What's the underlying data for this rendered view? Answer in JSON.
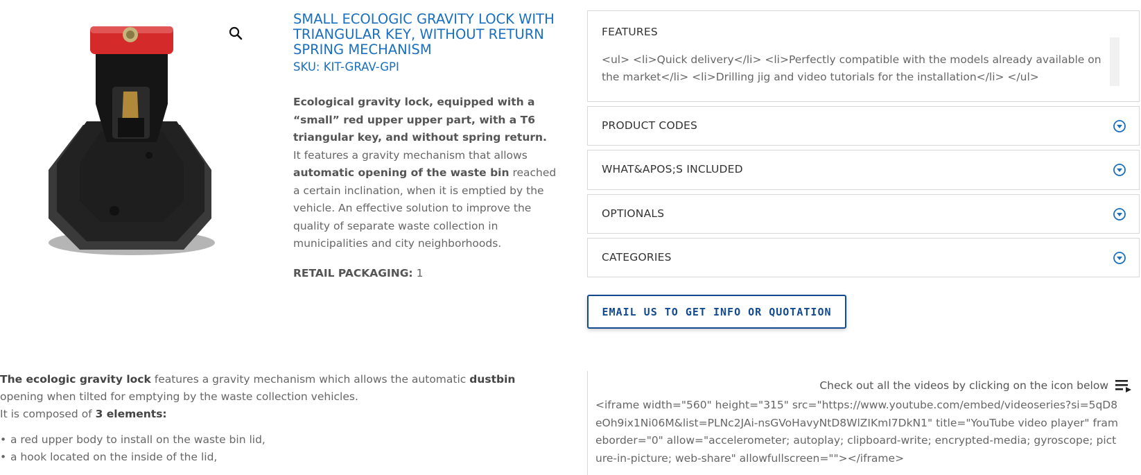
{
  "product": {
    "title": "SMALL ECOLOGIC GRAVITY LOCK WITH TRIANGULAR KEY, WITHOUT RETURN SPRING MECHANISM",
    "sku": "SKU: KIT-GRAV-GPI",
    "desc_bold_1": "Ecological gravity lock, equipped with a “small” red upper upper part, with a T6 triangular key, and without spring return.",
    "desc_1": " It features a gravity mechanism that allows ",
    "desc_bold_2": "automatic opening of the waste bin",
    "desc_2": " reached a certain inclination, when it is emptied by the vehicle. An effective solution to improve the quality of separate waste collection in municipalities and city neighborhoods.",
    "retail_label": "RETAIL PACKAGING:",
    "retail_value": " 1",
    "zoom_icon": "magnifier-icon"
  },
  "accordion": {
    "features_title": "FEATURES",
    "features_body": "<ul> <li>Quick delivery</li> <li>Perfectly compatible with the models already available on the market</li> <li>Drilling jig and video tutorials for the installation</li> </ul>",
    "product_codes": "PRODUCT CODES",
    "included": "WHAT&APOS;S INCLUDED",
    "optionals": "OPTIONALS",
    "categories": "CATEGORIES",
    "toggle_icon": "chevron-circle-down-icon"
  },
  "cta": {
    "email_label": "EMAIL US TO GET INFO OR QUOTATION"
  },
  "lower": {
    "bold_1": "The ecologic gravity lock",
    "text_1": " features a gravity mechanism which allows the automatic ",
    "bold_2": "dustbin",
    "text_2": " opening when tilted for emptying by the waste collection vehicles.",
    "composed_text": "It is composed of ",
    "composed_bold": "3 elements:",
    "items": [
      "a red upper body to install on the waste bin lid,",
      "a hook located on the inside of the lid,"
    ]
  },
  "video": {
    "hint": "Check out all the videos by clicking on the icon below",
    "playlist_icon": "playlist-icon",
    "iframe_code": "<iframe width=\"560\" height=\"315\" src=\"https://www.youtube.com/embed/videoseries?si=5qD8eOh9ix1Ni06M&list=PLNc2JAi-nsGVoHavyNtD8WlZIKmI7DkN1\" title=\"YouTube video player\" frameborder=\"0\" allow=\"accelerometer; autoplay; clipboard-write; encrypted-media; gyroscope; picture-in-picture; web-share\" allowfullscreen=\"\"></iframe>"
  },
  "colors": {
    "accent": "#1a6fc0",
    "button": "#12498f",
    "lock_red": "#d42a2a"
  }
}
